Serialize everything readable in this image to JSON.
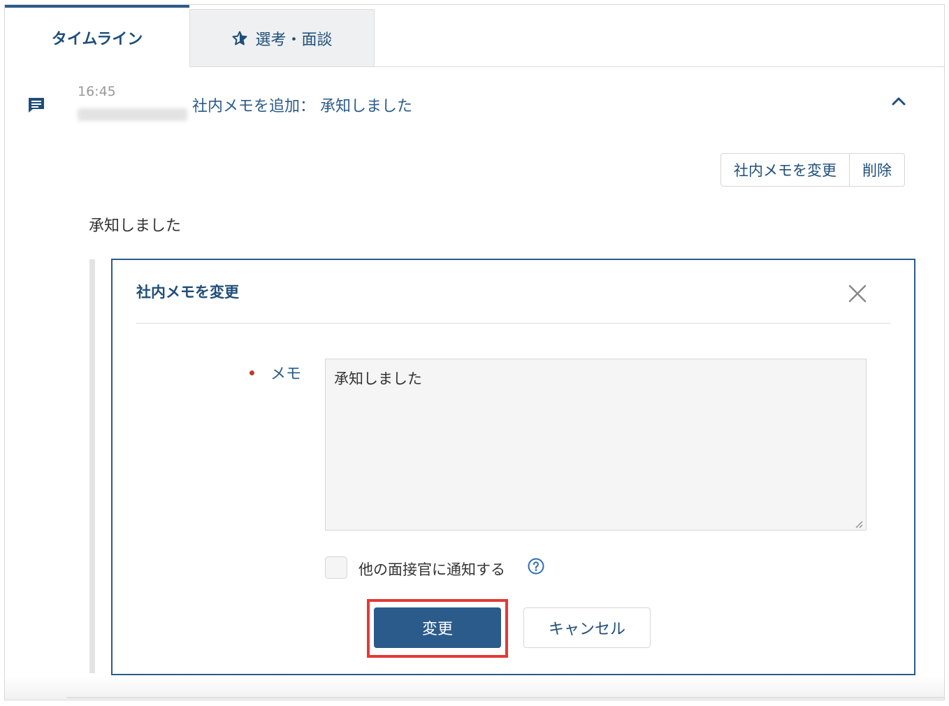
{
  "tabs": [
    {
      "label": "タイムライン",
      "active": true
    },
    {
      "label": "選考・面談",
      "icon": "star-icon",
      "active": false
    }
  ],
  "entry": {
    "icon": "comment-icon",
    "time": "16:45",
    "title": "社内メモを追加： 承知しました",
    "actions": {
      "edit_label": "社内メモを変更",
      "delete_label": "削除"
    },
    "memo_text": "承知しました"
  },
  "edit_panel": {
    "title": "社内メモを変更",
    "memo_label": "メモ",
    "memo_value": "承知しました",
    "notify_label": "他の面接官に通知する",
    "notify_checked": false,
    "submit_label": "変更",
    "cancel_label": "キャンセル"
  },
  "colors": {
    "accent": "#2b5b8b",
    "required": "#c0392b",
    "highlight": "#e53935"
  }
}
